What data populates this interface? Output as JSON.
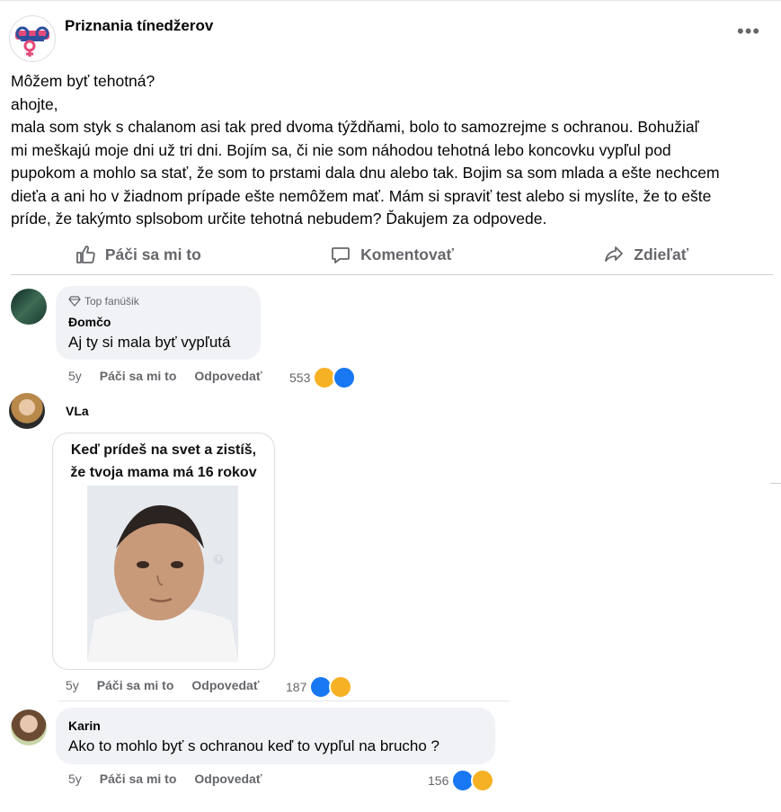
{
  "post": {
    "page_name": "Priznania tínedžerov",
    "more_label": "•••",
    "lines": [
      "Môžem byť tehotná?",
      "ahojte,",
      "mala som styk s chalanom asi tak pred dvoma  týždňami, bolo to samozrejme  s ochranou. Bohužiaľ",
      "mi meškajú moje dni už tri dni. Bojím sa, či nie som náhodou tehotná lebo koncovku vypľul pod",
      "pupokom a mohlo sa stať, že som to prstami dala dnu alebo tak. Bojim sa som mlada a ešte nechcem",
      "dieťa a ani ho v žiadnom prípade ešte nemôžem mať. Mám si spraviť test alebo si myslíte, že to ešte",
      "príde, že takýmto splsobom určite tehotná nebudem? Ďakujem za odpovede."
    ]
  },
  "actions": {
    "like": "Páči sa mi to",
    "comment": "Komentovať",
    "share": "Zdieľať"
  },
  "comments": [
    {
      "badge": "Top fanúšik",
      "author": "Đomčo",
      "text": "Aj ty si mala byť vypľutá",
      "age": "5y",
      "like": "Páči sa mi to",
      "reply": "Odpovedať",
      "count": "553"
    },
    {
      "author": "VLa",
      "meme_caption_1": "Keď prídeš na svet a zistíš,",
      "meme_caption_2": "že tvoja mama má 16 rokov",
      "age": "5y",
      "like": "Páči sa mi to",
      "reply": "Odpovedať",
      "count": "187"
    },
    {
      "author": "Karin",
      "text": "Ako to mohlo byť s ochranou keď to vypľul na brucho ?",
      "age": "5y",
      "like": "Páči sa mi to",
      "reply": "Odpovedať",
      "count": "156"
    }
  ],
  "colors": {
    "like_blue": "#1877f2",
    "haha_yellow": "#f7b125",
    "bubble_bg": "#f0f2f5",
    "meta_gray": "#65676b"
  },
  "icons": [
    "more-icon",
    "like-icon",
    "comment-icon",
    "share-icon",
    "diamond-icon",
    "like-reaction-icon",
    "haha-reaction-icon"
  ]
}
